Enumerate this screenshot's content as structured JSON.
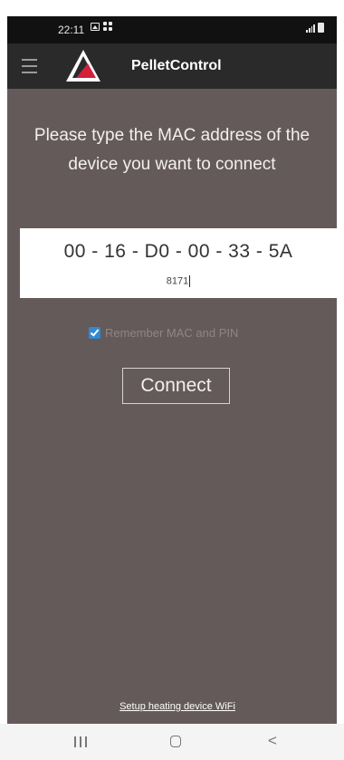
{
  "status_bar": {
    "time": "22:11",
    "icons_left": [
      "image-icon",
      "grid-dots-icon"
    ],
    "icons_right": [
      "signal-icon",
      "battery-icon"
    ]
  },
  "app_bar": {
    "title": "PelletControl",
    "menu_icon": "hamburger-menu-icon",
    "logo_icon": "red-triangle-logo-icon",
    "logo_color": "#d4203a"
  },
  "main": {
    "background_color": "#645a59",
    "prompt": "Please type the MAC address of the device you want to connect",
    "mac_field": {
      "value": "00 - 16 - D0 - 00 - 33 - 5A"
    },
    "pin_field": {
      "value": "8171"
    },
    "remember": {
      "label": "Remember MAC and PIN",
      "checked": true,
      "checkbox_color": "#2f8ad1"
    },
    "connect_label": "Connect",
    "setup_link": "Setup heating device WiFi"
  },
  "nav_bar": {
    "recent_icon": "recent-apps-icon",
    "home_icon": "home-icon",
    "back_icon": "back-chevron-icon",
    "back_glyph": "<"
  }
}
